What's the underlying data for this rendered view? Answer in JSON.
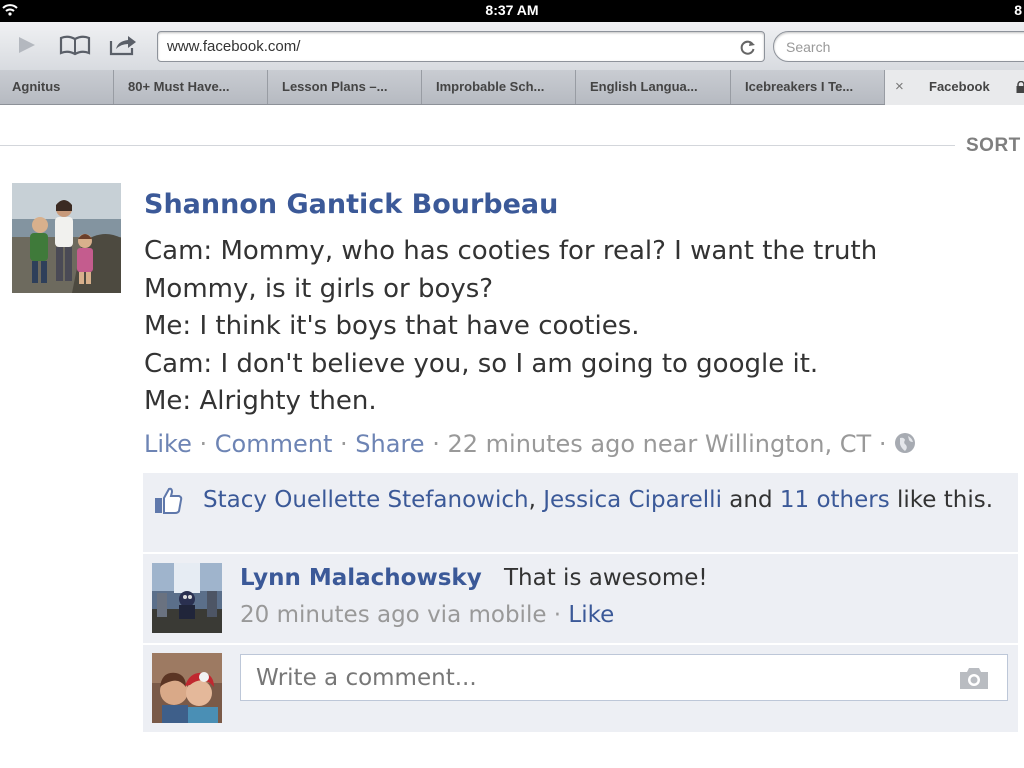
{
  "status_bar": {
    "time": "8:37 AM",
    "battery": "8"
  },
  "toolbar": {
    "url": "www.facebook.com/",
    "search_placeholder": "Search"
  },
  "tabs": [
    {
      "label": "Agnitus"
    },
    {
      "label": "80+ Must Have..."
    },
    {
      "label": "Lesson Plans –..."
    },
    {
      "label": "Improbable Sch..."
    },
    {
      "label": "English Langua..."
    },
    {
      "label": "Icebreakers I Te..."
    },
    {
      "label": "Facebook",
      "active": true,
      "close": "×"
    }
  ],
  "feed": {
    "sort_label": "SORT"
  },
  "post": {
    "author": "Shannon Gantick Bourbeau",
    "body_lines": [
      "Cam: Mommy, who has cooties for real? I want the truth",
      "Mommy, is it girls or boys?",
      "Me: I think it's boys that have cooties.",
      "Cam: I don't believe you, so I am going to google it.",
      "Me: Alrighty then."
    ],
    "actions": {
      "like": "Like",
      "comment": "Comment",
      "share": "Share",
      "sep": "·",
      "time_location": "22 minutes ago near Willington, CT"
    },
    "likes": {
      "person1": "Stacy Ouellette Stefanowich",
      "comma": ",",
      "person2": "Jessica Ciparelli",
      "and": "and",
      "others": "11 others",
      "suffix": "like this."
    },
    "comment": {
      "author": "Lynn Malachowsky",
      "text": "That is awesome!",
      "meta": "20 minutes ago via mobile",
      "sep": "·",
      "like": "Like"
    },
    "write_comment_placeholder": "Write a comment..."
  },
  "colors": {
    "fb_blue": "#3b5998",
    "fb_link_light": "#6d84b4",
    "comment_bg": "#edeff4"
  }
}
